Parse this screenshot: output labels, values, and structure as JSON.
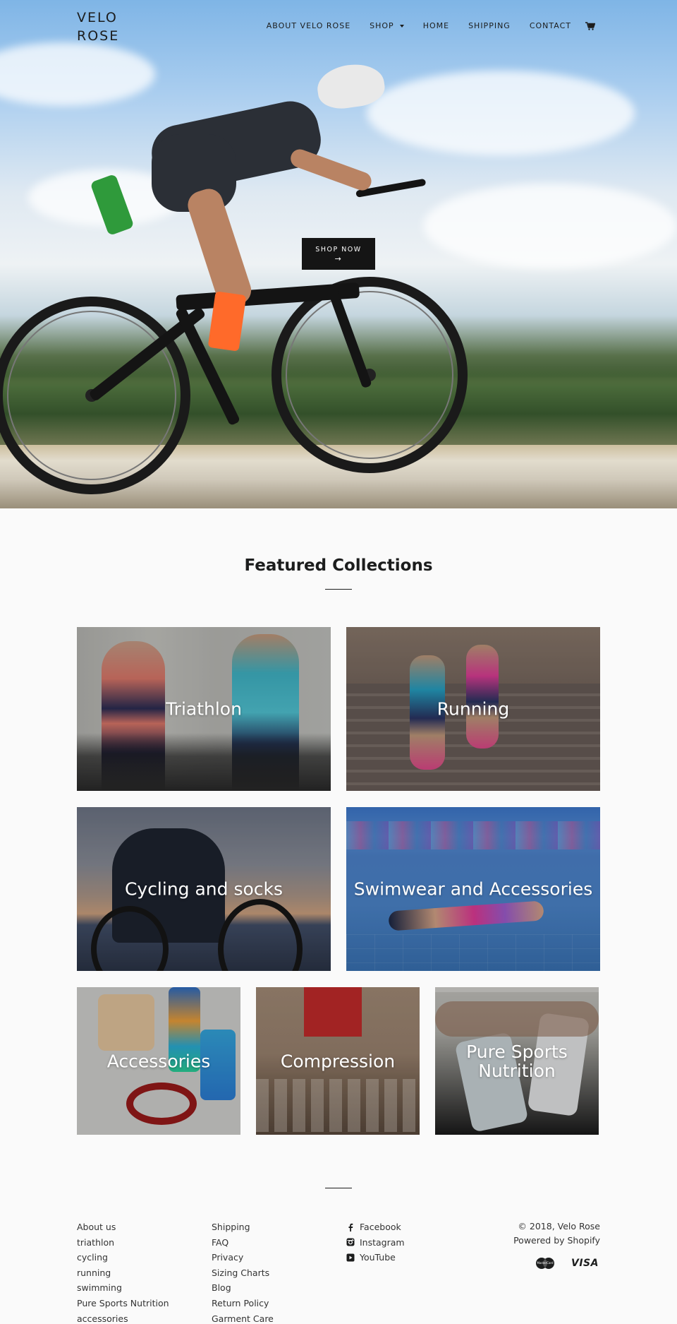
{
  "header": {
    "logo": "VELO ROSE",
    "menu": [
      {
        "label": "ABOUT VELO ROSE",
        "dropdown": false
      },
      {
        "label": "SHOP",
        "dropdown": true
      },
      {
        "label": "HOME",
        "dropdown": false
      },
      {
        "label": "SHIPPING",
        "dropdown": false
      },
      {
        "label": "CONTACT",
        "dropdown": false
      }
    ],
    "cart_icon": "cart-icon"
  },
  "hero": {
    "button_label": "SHOP NOW",
    "button_arrow": "→"
  },
  "featured": {
    "title": "Featured Collections",
    "collections": [
      {
        "label": "Triathlon"
      },
      {
        "label": "Running"
      },
      {
        "label": "Cycling and socks"
      },
      {
        "label": "Swimwear and Accessories"
      },
      {
        "label": "Accessories"
      },
      {
        "label": "Compression"
      },
      {
        "label": "Pure Sports Nutrition"
      }
    ]
  },
  "footer": {
    "col1": [
      "About us",
      "triathlon",
      "cycling",
      "running",
      "swimming",
      "Pure Sports Nutrition",
      "accessories"
    ],
    "col2": [
      "Shipping",
      "FAQ",
      "Privacy",
      "Sizing Charts",
      "Blog",
      "Return Policy",
      "Garment Care"
    ],
    "social": [
      {
        "label": "Facebook",
        "icon": "facebook-icon"
      },
      {
        "label": "Instagram",
        "icon": "instagram-icon"
      },
      {
        "label": "YouTube",
        "icon": "youtube-icon"
      }
    ],
    "copyright": "© 2018, Velo Rose",
    "powered": "Powered by Shopify",
    "payments": [
      {
        "label": "MasterCard",
        "icon": "mastercard-icon"
      },
      {
        "label": "VISA",
        "icon": "visa-icon"
      }
    ]
  }
}
